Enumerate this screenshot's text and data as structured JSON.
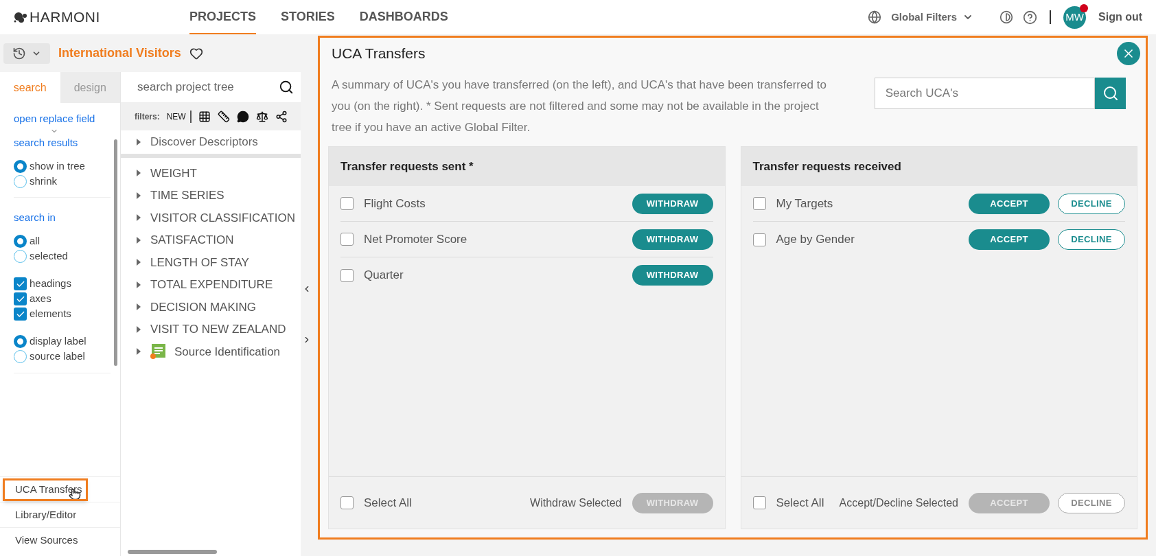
{
  "brand": {
    "name": "HARMONI"
  },
  "nav": [
    {
      "label": "PROJECTS",
      "selected": true
    },
    {
      "label": "STORIES",
      "selected": false
    },
    {
      "label": "DASHBOARDS",
      "selected": false
    }
  ],
  "header_right": {
    "global_filters": "Global Filters",
    "avatar": "MW",
    "notification": true,
    "sign_out": "Sign out"
  },
  "project": {
    "title": "International Visitors",
    "favorite": false
  },
  "side_tabs": [
    {
      "label": "search",
      "selected": true
    },
    {
      "label": "design",
      "selected": false
    }
  ],
  "search_options": {
    "replace_link": "open replace field",
    "groups": [
      {
        "title": "search results",
        "items": [
          {
            "kind": "radio",
            "label": "show in tree",
            "checked": true
          },
          {
            "kind": "radio",
            "label": "shrink",
            "checked": false
          }
        ]
      },
      {
        "title": "search in",
        "items": [
          {
            "kind": "radio",
            "label": "all",
            "checked": true
          },
          {
            "kind": "radio",
            "label": "selected",
            "checked": false
          },
          {
            "kind": "gap"
          },
          {
            "kind": "checkbox",
            "label": "headings",
            "checked": true
          },
          {
            "kind": "checkbox",
            "label": "axes",
            "checked": true
          },
          {
            "kind": "checkbox",
            "label": "elements",
            "checked": true
          },
          {
            "kind": "gap"
          },
          {
            "kind": "radio",
            "label": "display label",
            "checked": true
          },
          {
            "kind": "radio",
            "label": "source label",
            "checked": false
          }
        ]
      }
    ]
  },
  "bottom_links": [
    {
      "label": "UCA Transfers",
      "selected": true
    },
    {
      "label": "Library/Editor",
      "selected": false
    },
    {
      "label": "View Sources",
      "selected": false
    }
  ],
  "tree": {
    "placeholder": "search project tree",
    "filters_label": "filters:",
    "filters_new": "NEW",
    "pinned": [
      {
        "label": "Discover Descriptors",
        "kind": "folder"
      }
    ],
    "items": [
      {
        "label": "WEIGHT",
        "kind": "folder"
      },
      {
        "label": "TIME SERIES",
        "kind": "folder"
      },
      {
        "label": "VISITOR CLASSIFICATION",
        "kind": "folder"
      },
      {
        "label": "SATISFACTION",
        "kind": "folder"
      },
      {
        "label": "LENGTH OF STAY",
        "kind": "folder"
      },
      {
        "label": "TOTAL EXPENDITURE",
        "kind": "folder"
      },
      {
        "label": "DECISION MAKING",
        "kind": "folder"
      },
      {
        "label": "VISIT TO NEW ZEALAND",
        "kind": "folder"
      },
      {
        "label": "Source Identification",
        "kind": "source"
      }
    ]
  },
  "modal": {
    "title": "UCA Transfers",
    "description": "A summary of UCA's you have transferred (on the left), and UCA's that have been transferred to you (on the right). * Sent requests are not filtered and some may not be available in the project tree if you have an active Global Filter.",
    "search": {
      "placeholder": "Search UCA's"
    },
    "columns": [
      {
        "title": "Transfer requests sent *",
        "rows": [
          {
            "label": "Flight Costs",
            "checked": false,
            "actions": [
              {
                "label": "WITHDRAW",
                "kind": "primary",
                "disabled": false
              }
            ]
          },
          {
            "label": "Net Promoter Score",
            "checked": false,
            "actions": [
              {
                "label": "WITHDRAW",
                "kind": "primary",
                "disabled": false
              }
            ]
          },
          {
            "label": "Quarter",
            "checked": false,
            "actions": [
              {
                "label": "WITHDRAW",
                "kind": "primary",
                "disabled": false
              }
            ]
          }
        ],
        "select_all": {
          "label": "Select All",
          "checked": false
        },
        "bulk_label": "Withdraw Selected",
        "bulk_actions": [
          {
            "label": "WITHDRAW",
            "kind": "primary",
            "disabled": true
          }
        ]
      },
      {
        "title": "Transfer requests received",
        "rows": [
          {
            "label": "My Targets",
            "checked": false,
            "actions": [
              {
                "label": "ACCEPT",
                "kind": "primary",
                "disabled": false
              },
              {
                "label": "DECLINE",
                "kind": "outline",
                "disabled": false
              }
            ]
          },
          {
            "label": "Age by Gender",
            "checked": false,
            "actions": [
              {
                "label": "ACCEPT",
                "kind": "primary",
                "disabled": false
              },
              {
                "label": "DECLINE",
                "kind": "outline",
                "disabled": false
              }
            ]
          }
        ],
        "select_all": {
          "label": "Select All",
          "checked": false
        },
        "bulk_label": "Accept/Decline Selected",
        "bulk_actions": [
          {
            "label": "ACCEPT",
            "kind": "primary",
            "disabled": true
          },
          {
            "label": "DECLINE",
            "kind": "outline",
            "disabled": true
          }
        ]
      }
    ]
  }
}
